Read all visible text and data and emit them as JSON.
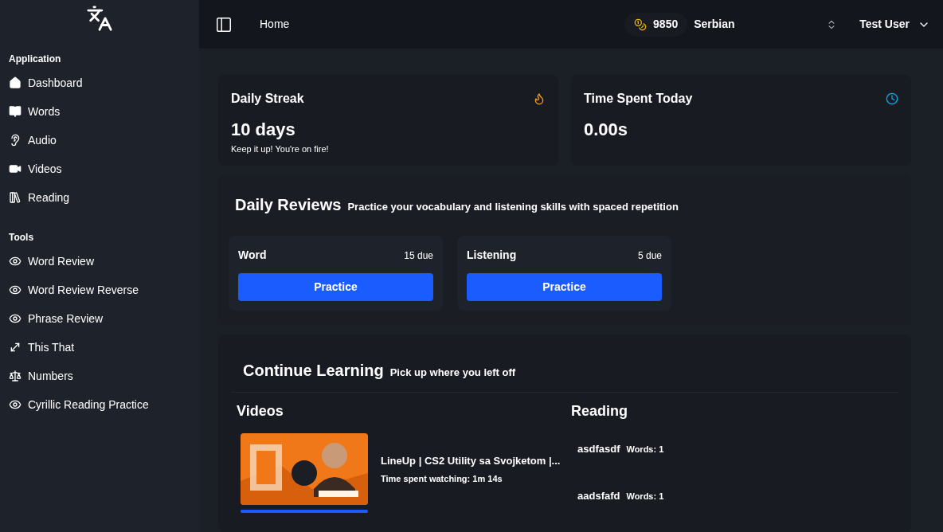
{
  "sidebar": {
    "groups": [
      {
        "label": "Application",
        "items": [
          {
            "kind": "home",
            "label": "Dashboard"
          },
          {
            "kind": "book",
            "label": "Words"
          },
          {
            "kind": "ear",
            "label": "Audio"
          },
          {
            "kind": "video",
            "label": "Videos"
          },
          {
            "kind": "library",
            "label": "Reading"
          }
        ]
      },
      {
        "label": "Tools",
        "items": [
          {
            "kind": "eye",
            "label": "Word Review"
          },
          {
            "kind": "eye",
            "label": "Word Review Reverse"
          },
          {
            "kind": "eye",
            "label": "Phrase Review"
          },
          {
            "kind": "arrows",
            "label": "This That"
          },
          {
            "kind": "scale",
            "label": "Numbers"
          },
          {
            "kind": "eye",
            "label": "Cyrillic Reading Practice"
          }
        ]
      }
    ]
  },
  "header": {
    "breadcrumb": "Home",
    "coins": "9850",
    "language": "Serbian",
    "user": "Test User"
  },
  "stats": [
    {
      "kind": "streak",
      "title": "Daily Streak",
      "value": "10 days",
      "note": "Keep it up! You're on fire!"
    },
    {
      "kind": "time",
      "title": "Time Spent Today",
      "value": "0.00s"
    }
  ],
  "daily_reviews": {
    "title": "Daily Reviews",
    "subtitle": "Practice your vocabulary and listening skills with spaced repetition",
    "cards": [
      {
        "title": "Word",
        "due": "15 due",
        "button": "Practice"
      },
      {
        "title": "Listening",
        "due": "5 due",
        "button": "Practice"
      }
    ]
  },
  "continue_learning": {
    "title": "Continue Learning",
    "subtitle": "Pick up where you left off",
    "videos": {
      "heading": "Videos",
      "items": [
        {
          "kind": "picture",
          "title": "LineUp | CS2 Utility sa Svojketom |...",
          "time": "Time spent watching: 1m 14s",
          "level": 1
        }
      ]
    },
    "reading": {
      "heading": "Reading",
      "items": [
        {
          "title": "asdfasdf",
          "words": "Words: 1"
        },
        {
          "title": "aadsfafd",
          "words": "Words: 1"
        }
      ]
    }
  }
}
